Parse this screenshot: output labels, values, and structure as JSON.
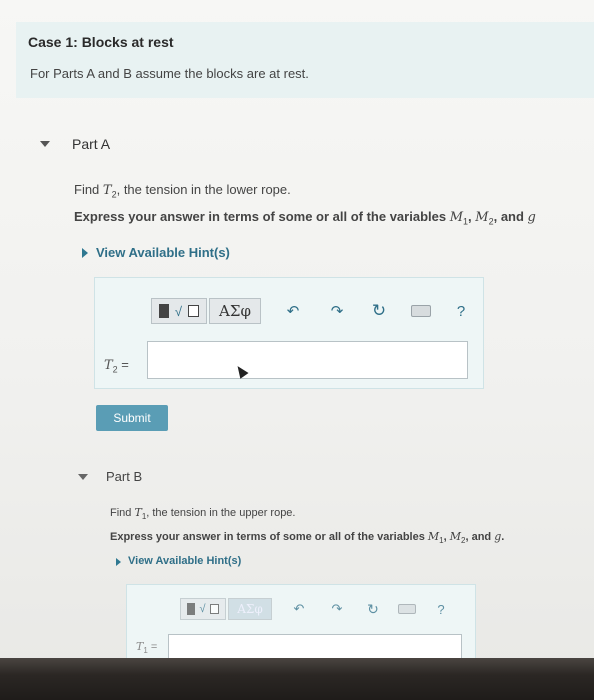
{
  "case": {
    "title": "Case 1: Blocks at rest",
    "description": "For Parts A and B assume the blocks are at rest."
  },
  "partA": {
    "label": "Part A",
    "find_prefix": "Find ",
    "find_var": "T",
    "find_sub": "2",
    "find_suffix": ", the tension in the lower rope.",
    "express_prefix": "Express your answer in terms of some or all of the variables ",
    "var1": "M",
    "var1_sub": "1",
    "comma1": ", ",
    "var2": "M",
    "var2_sub": "2",
    "and_text": ", and ",
    "var3": "g",
    "hint": "View Available Hint(s)",
    "toolbar": {
      "templates_icon": "matrix-sqrt-icon",
      "greek_label": "ΑΣφ",
      "undo": "↶",
      "redo": "↷",
      "reset": "↻",
      "help": "?"
    },
    "eq_var": "T",
    "eq_sub": "2",
    "eq_sign": " =",
    "input_value": "",
    "submit": "Submit"
  },
  "partB": {
    "label": "Part B",
    "find_prefix": "Find ",
    "find_var": "T",
    "find_sub": "1",
    "find_suffix": ", the tension in the upper rope.",
    "express_prefix": "Express your answer in terms of some or all of the variables ",
    "var1": "M",
    "var1_sub": "1",
    "comma1": ", ",
    "var2": "M",
    "var2_sub": "2",
    "and_text": ", and ",
    "var3": "g",
    "period": ".",
    "hint": "View Available Hint(s)",
    "toolbar": {
      "greek_label": "ΑΣφ",
      "undo": "↶",
      "redo": "↷",
      "reset": "↻",
      "help": "?"
    },
    "eq_var": "T",
    "eq_sub": "1",
    "eq_sign": " ="
  },
  "colors": {
    "accent": "#2f6f88",
    "submit_bg": "#5a9db5",
    "case_bg": "#e8f2f2",
    "panel_bg": "#eef6f6"
  }
}
